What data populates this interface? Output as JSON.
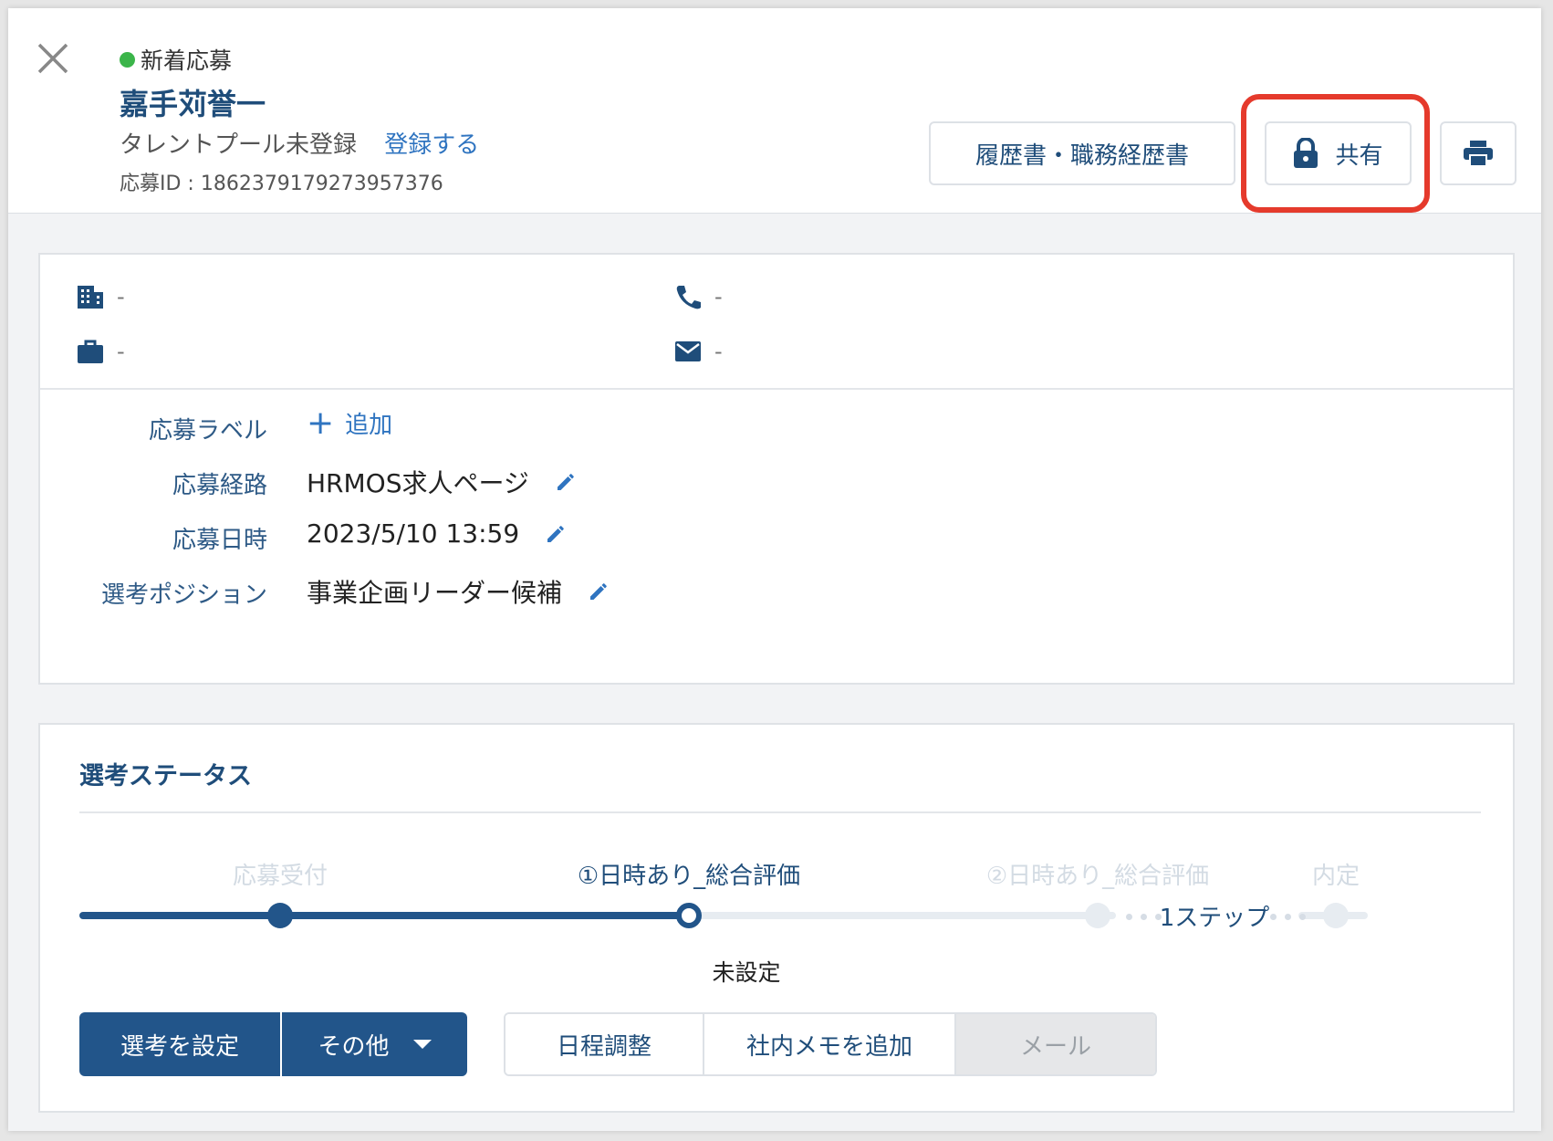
{
  "header": {
    "status_badge": "新着応募",
    "candidate_name": "嘉手苅誉一",
    "talent_pool_status": "タレントプール未登録",
    "register_link": "登録する",
    "application_id": "応募ID : 1862379179273957376"
  },
  "toolbar": {
    "resume_label": "履歴書・職務経歴書",
    "share_label": "共有",
    "print_icon": "printer-icon"
  },
  "contact": {
    "company": "-",
    "phone": "-",
    "job": "-",
    "email": "-"
  },
  "fields": {
    "label_title": "応募ラベル",
    "add_label": "追加",
    "route_title": "応募経路",
    "route_value": "HRMOS求人ページ",
    "date_title": "応募日時",
    "date_value": "2023/5/10 13:59",
    "position_title": "選考ポジション",
    "position_value": "事業企画リーダー候補"
  },
  "selection": {
    "title": "選考ステータス",
    "steps": [
      {
        "label": "応募受付",
        "state": "done"
      },
      {
        "label": "①日時あり_総合評価",
        "state": "current"
      },
      {
        "label": "②日時あり_総合評価",
        "state": "future"
      },
      {
        "label": "内定",
        "state": "future"
      }
    ],
    "skip_text": "1ステップ",
    "current_status": "未設定",
    "btn_set": "選考を設定",
    "btn_other": "その他",
    "btn_schedule": "日程調整",
    "btn_memo": "社内メモを追加",
    "btn_mail": "メール"
  },
  "colors": {
    "primary": "#22558a",
    "link": "#2f74c0",
    "badge_dot": "#3bb54a",
    "highlight": "#e53a2c"
  }
}
